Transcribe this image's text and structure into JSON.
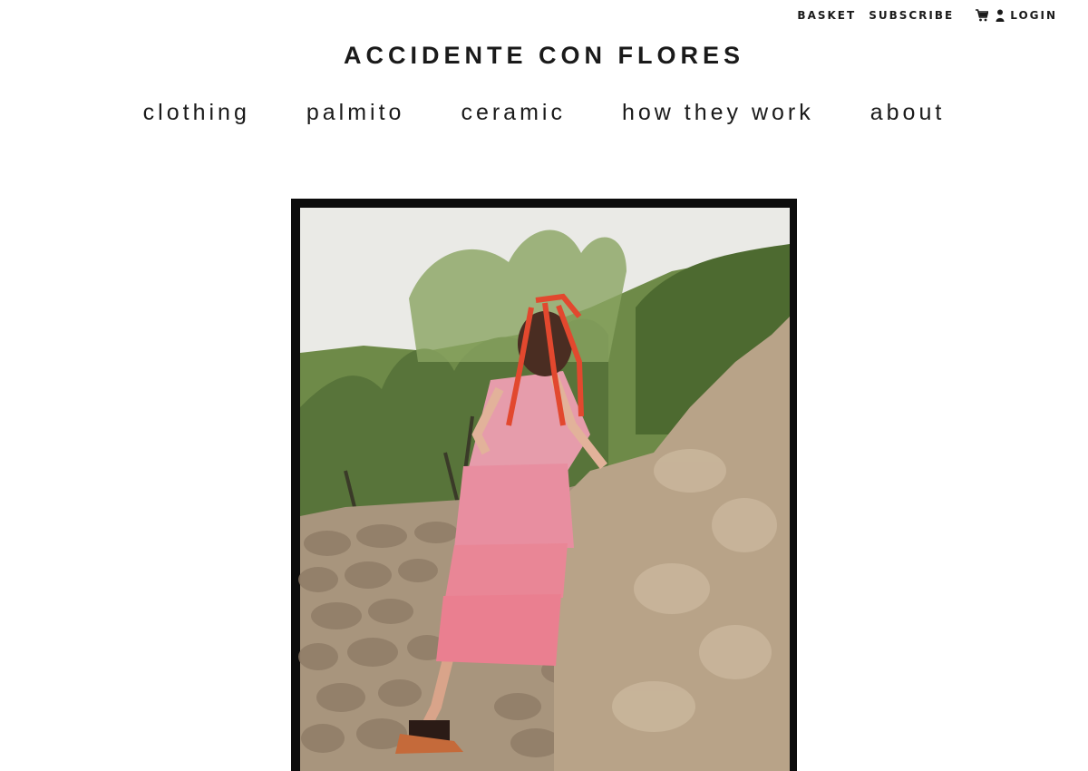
{
  "header": {
    "utility": {
      "basket_label": "BASKET",
      "subscribe_label": "SUBSCRIBE",
      "cart_icon": "cart-icon",
      "user_icon": "user-icon",
      "login_label": "LOGIN"
    },
    "site_title": "ACCIDENTE CON FLORES"
  },
  "nav": {
    "items": [
      {
        "label": "clothing"
      },
      {
        "label": "palmito"
      },
      {
        "label": "ceramic"
      },
      {
        "label": "how they work"
      },
      {
        "label": "about"
      }
    ]
  },
  "hero": {
    "subject": "photo-woman-pink-tiered-dress-stone-wall",
    "colors": {
      "frame": "#0c0c0c",
      "sky": "#e6e6e2",
      "foliage": "#5f7a3c",
      "dress": "#e79aa8",
      "ribbons": "#e2482e",
      "stone": "#b39f86"
    }
  }
}
